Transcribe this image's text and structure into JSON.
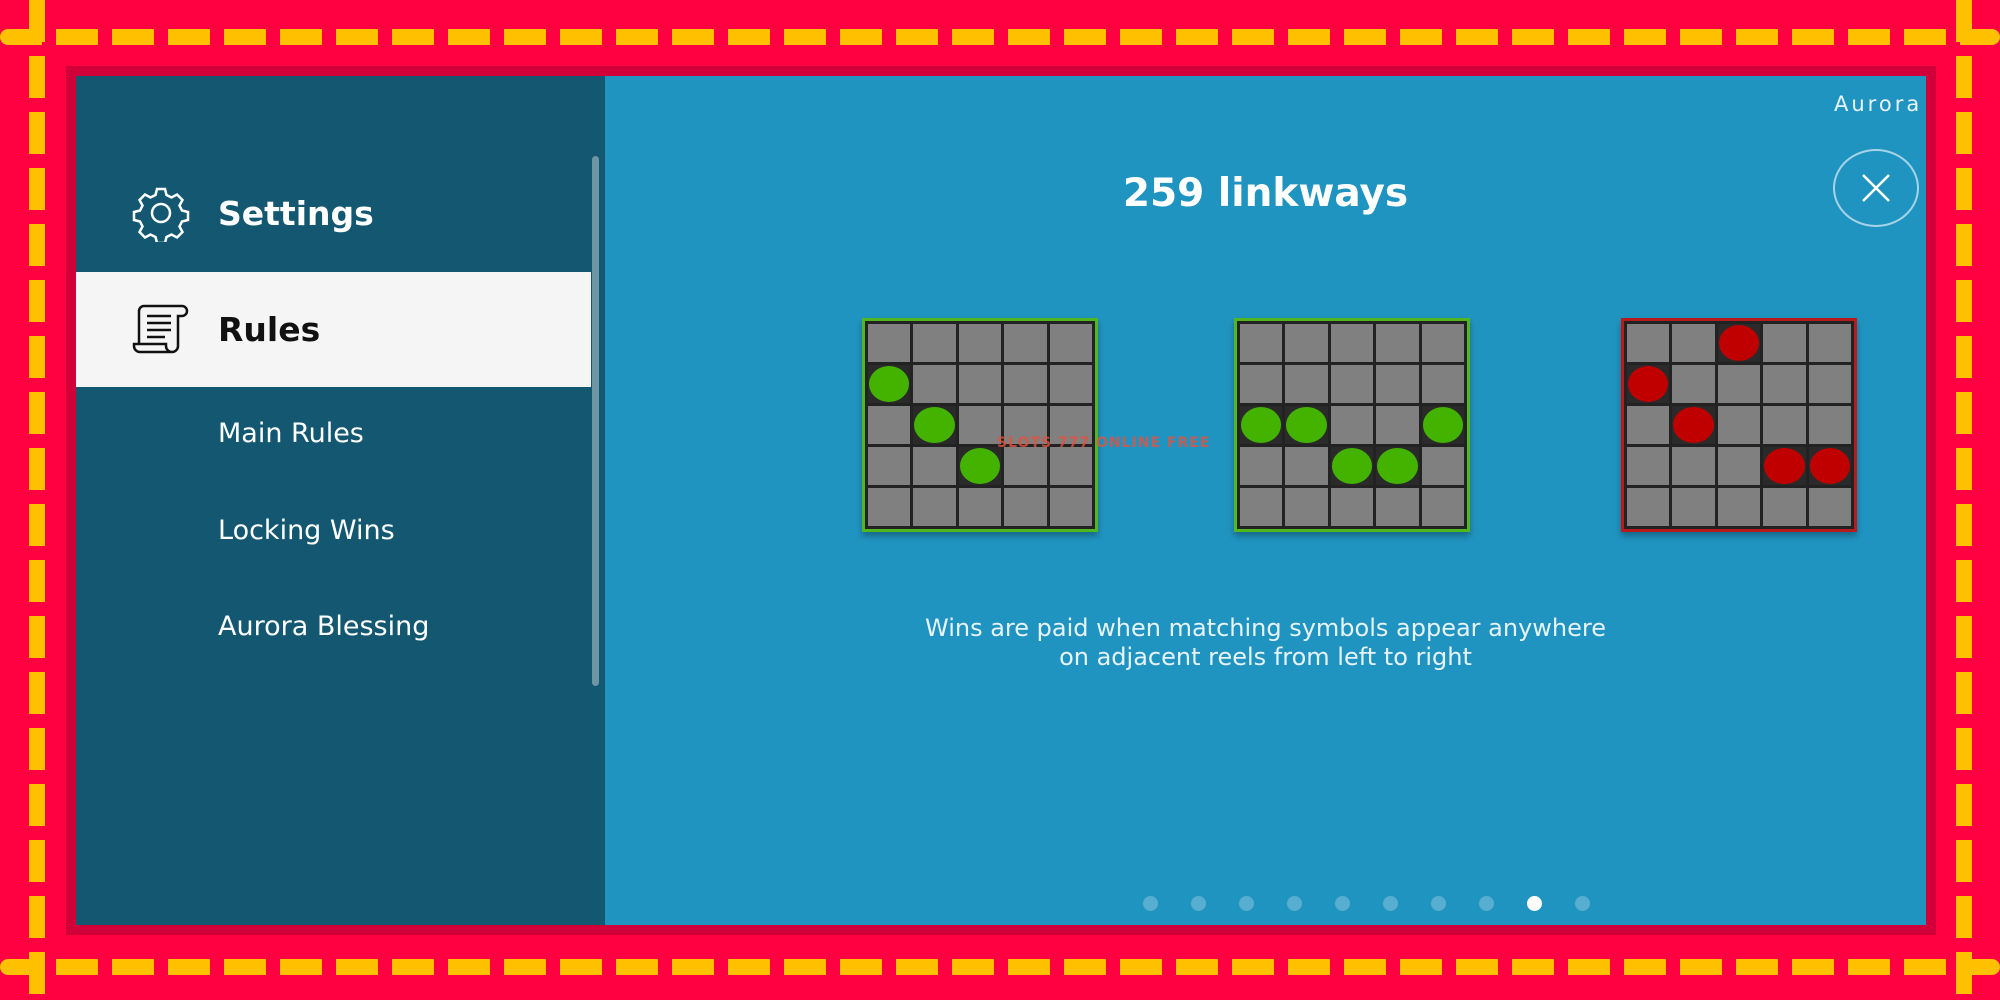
{
  "frame": {
    "border_color": "#ff0040",
    "dash_color": "#ffc000"
  },
  "sidebar": {
    "settings_label": "Settings",
    "rules_label": "Rules",
    "items": [
      {
        "label": "Main Rules"
      },
      {
        "label": "Locking Wins"
      },
      {
        "label": "Aurora Blessing"
      }
    ]
  },
  "main": {
    "game_name": "Aurora Ange",
    "title": "259 linkways",
    "description_line1": "Wins are paid when matching symbols appear anywhere",
    "description_line2": "on adjacent reels from left to right",
    "watermark": "SLOTS 777 ONLINE FREE",
    "pagination": {
      "total": 10,
      "active_index": 8
    },
    "examples": [
      {
        "status": "win",
        "border_color": "#52b71f",
        "symbol_color": "#44b300",
        "hits": [
          [
            1,
            0
          ],
          [
            2,
            1
          ],
          [
            3,
            2
          ]
        ]
      },
      {
        "status": "win",
        "border_color": "#52b71f",
        "symbol_color": "#44b300",
        "hits": [
          [
            2,
            0
          ],
          [
            2,
            1
          ],
          [
            3,
            2
          ],
          [
            3,
            3
          ],
          [
            2,
            4
          ]
        ]
      },
      {
        "status": "no-win",
        "border_color": "#b81b1b",
        "symbol_color": "#c00000",
        "hits": [
          [
            1,
            0
          ],
          [
            2,
            1
          ],
          [
            0,
            2
          ],
          [
            3,
            3
          ],
          [
            3,
            4
          ]
        ]
      }
    ]
  }
}
